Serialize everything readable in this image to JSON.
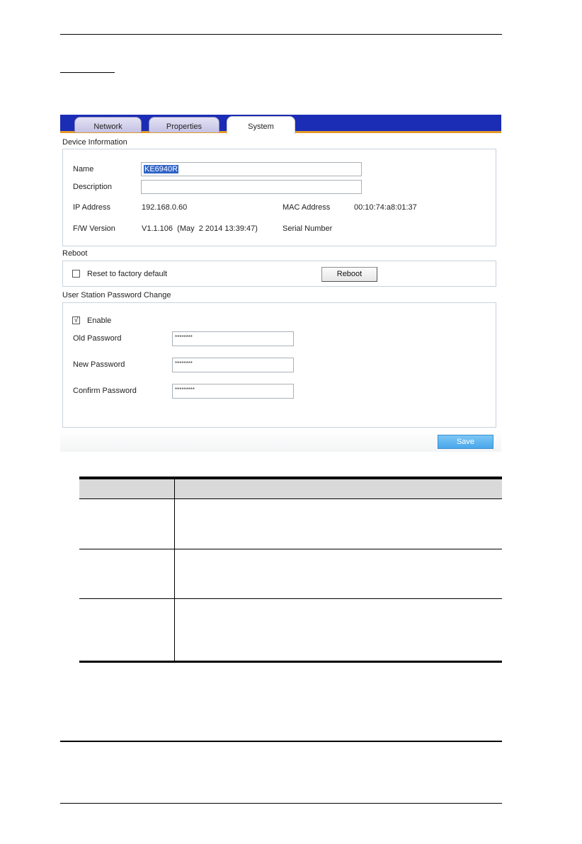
{
  "tabs": [
    {
      "label": "Network"
    },
    {
      "label": "Properties"
    },
    {
      "label": "System"
    }
  ],
  "device_information": {
    "title": "Device Information",
    "name_label": "Name",
    "name_value": "KE6940R",
    "description_label": "Description",
    "description_value": "",
    "ip_label": "IP Address",
    "ip_value": "192.168.0.60",
    "mac_label": "MAC Address",
    "mac_value": "00:10:74:a8:01:37",
    "fw_label": "F/W Version",
    "fw_value": "V1.1.106  (May  2 2014 13:39:47)",
    "serial_label": "Serial Number",
    "serial_value": ""
  },
  "reboot": {
    "title": "Reboot",
    "reset_label": "Reset to factory default",
    "reset_checked": false,
    "button_label": "Reboot"
  },
  "password_change": {
    "title": "User Station Password Change",
    "enable_label": "Enable",
    "enable_checked": true,
    "check_mark": "√",
    "old_label": "Old Password",
    "old_value": "********",
    "new_label": "New Password",
    "new_value": "********",
    "confirm_label": "Confirm Password",
    "confirm_value": "*********"
  },
  "save_label": "Save",
  "colors": {
    "tabbar": "#1b2cb5",
    "tab_underline": "#e39a2a",
    "save_button": "#4aa7ea",
    "selection": "#2f63c8"
  }
}
